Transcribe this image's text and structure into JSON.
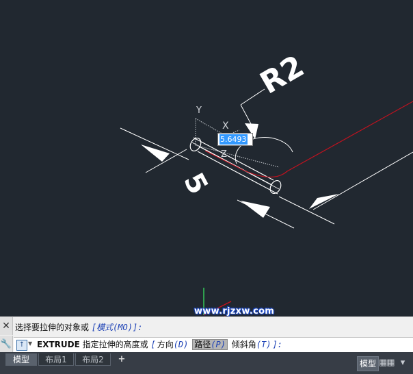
{
  "drawing": {
    "dim_radius": "R2",
    "dim_length": "5",
    "axis_y": "Y",
    "axis_x": "X",
    "axis_z": "Z",
    "line_color": "#ffffff",
    "path_color": "#c1121f",
    "ucs_color": "#34c759"
  },
  "tooltip": {
    "value": "5.6493"
  },
  "watermark": {
    "text": "www.rjzxw.com"
  },
  "command": {
    "history_prompt": "选择要拉伸的对象或",
    "history_option": "[模式(MO)]:",
    "command_name": "EXTRUDE",
    "prompt": "指定拉伸的高度或",
    "bracket_open": "[",
    "opt1_label": "方向",
    "opt1_key": "(D)",
    "opt2_label": "路径",
    "opt2_key": "(P)",
    "opt3_label": "倾斜角",
    "opt3_key": "(T)",
    "bracket_close": "]:"
  },
  "tabs": [
    {
      "label": "模型",
      "active": true
    },
    {
      "label": "布局1",
      "active": false
    },
    {
      "label": "布局2",
      "active": false
    }
  ],
  "add_tab": "+",
  "status": {
    "model": "模型"
  },
  "icons": {
    "close": "close-icon",
    "wrench": "wrench-icon",
    "command": "command-icon",
    "grid": "grid-icon",
    "arrow": "red-arrow-icon"
  }
}
